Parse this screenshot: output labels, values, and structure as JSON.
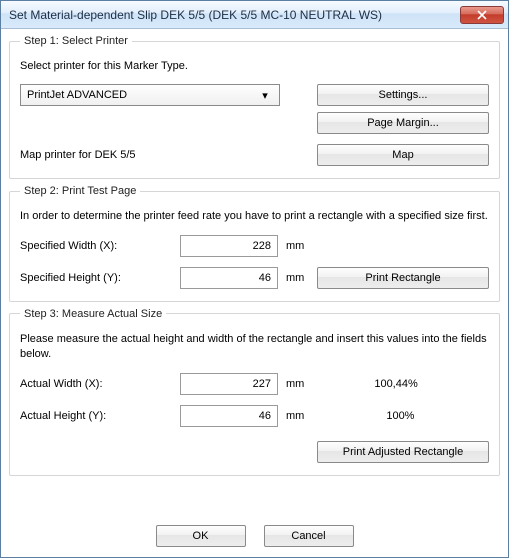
{
  "title": "Set Material-dependent Slip DEK 5/5 (DEK 5/5 MC-10 NEUTRAL WS)",
  "step1": {
    "legend": "Step 1: Select Printer",
    "instruction": "Select printer for this Marker Type.",
    "printer": "PrintJet ADVANCED",
    "settings_btn": "Settings...",
    "margin_btn": "Page Margin...",
    "map_label": "Map printer for DEK 5/5",
    "map_btn": "Map"
  },
  "step2": {
    "legend": "Step 2: Print Test Page",
    "instruction": "In order to determine the printer feed rate you have to print a rectangle with a specified size first.",
    "w_label": "Specified Width (X):",
    "w_value": "228",
    "h_label": "Specified Height (Y):",
    "h_value": "46",
    "unit": "mm",
    "print_btn": "Print Rectangle"
  },
  "step3": {
    "legend": "Step 3: Measure Actual Size",
    "instruction": "Please measure the actual height and width of the rectangle and insert this values into the fields below.",
    "w_label": "Actual Width (X):",
    "w_value": "227",
    "w_pct": "100,44%",
    "h_label": "Actual Height (Y):",
    "h_value": "46",
    "h_pct": "100%",
    "unit": "mm",
    "print_btn": "Print Adjusted Rectangle"
  },
  "buttons": {
    "ok": "OK",
    "cancel": "Cancel"
  }
}
